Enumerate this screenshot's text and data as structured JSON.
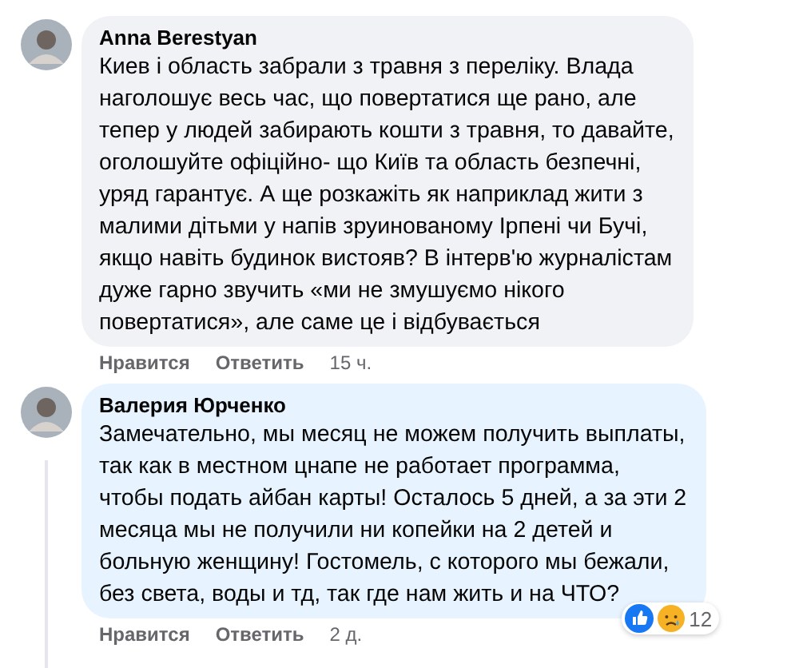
{
  "comments": [
    {
      "author": "Anna Berestyan",
      "text": "Киев і область забрали з травня з переліку. Влада\nнаголошує весь час, що повертатися ще рано, але\nтепер у людей забирають кошти з травня, то давайте,\nоголошуйте офіційно- що Київ та область безпечні,\nуряд гарантує. А ще розкажіть як наприклад жити з\nмалими дітьми у напів зруинованому Ірпені чи Бучі,\nякщо навіть будинок вистояв? В інтерв'ю журналістам\nдуже гарно звучить «ми не змушуємо нікого\nповертатися», але саме це і відбувається",
      "color": "#f0f2f5",
      "actions": [
        "Нравится",
        "Ответить"
      ],
      "time": "15 ч.",
      "thread": false
    },
    {
      "author": "Валерия Юрченко",
      "text": "Замечательно, мы месяц не можем получить выплаты,\nтак как в местном цнапе не работает программа,\nчтобы подать айбан карты! Осталось 5 дней, а за эти 2\nмесяца мы не получили ни копейки на 2 детей и\nбольную женщину! Гостомель, с которого мы бежали,\nбез света, воды и тд, так где нам жить и на ЧТО?",
      "color": "#e7f3ff",
      "actions": [
        "Нравится",
        "Ответить"
      ],
      "time": "2 д.",
      "thread": true,
      "reactions": "12"
    }
  ]
}
